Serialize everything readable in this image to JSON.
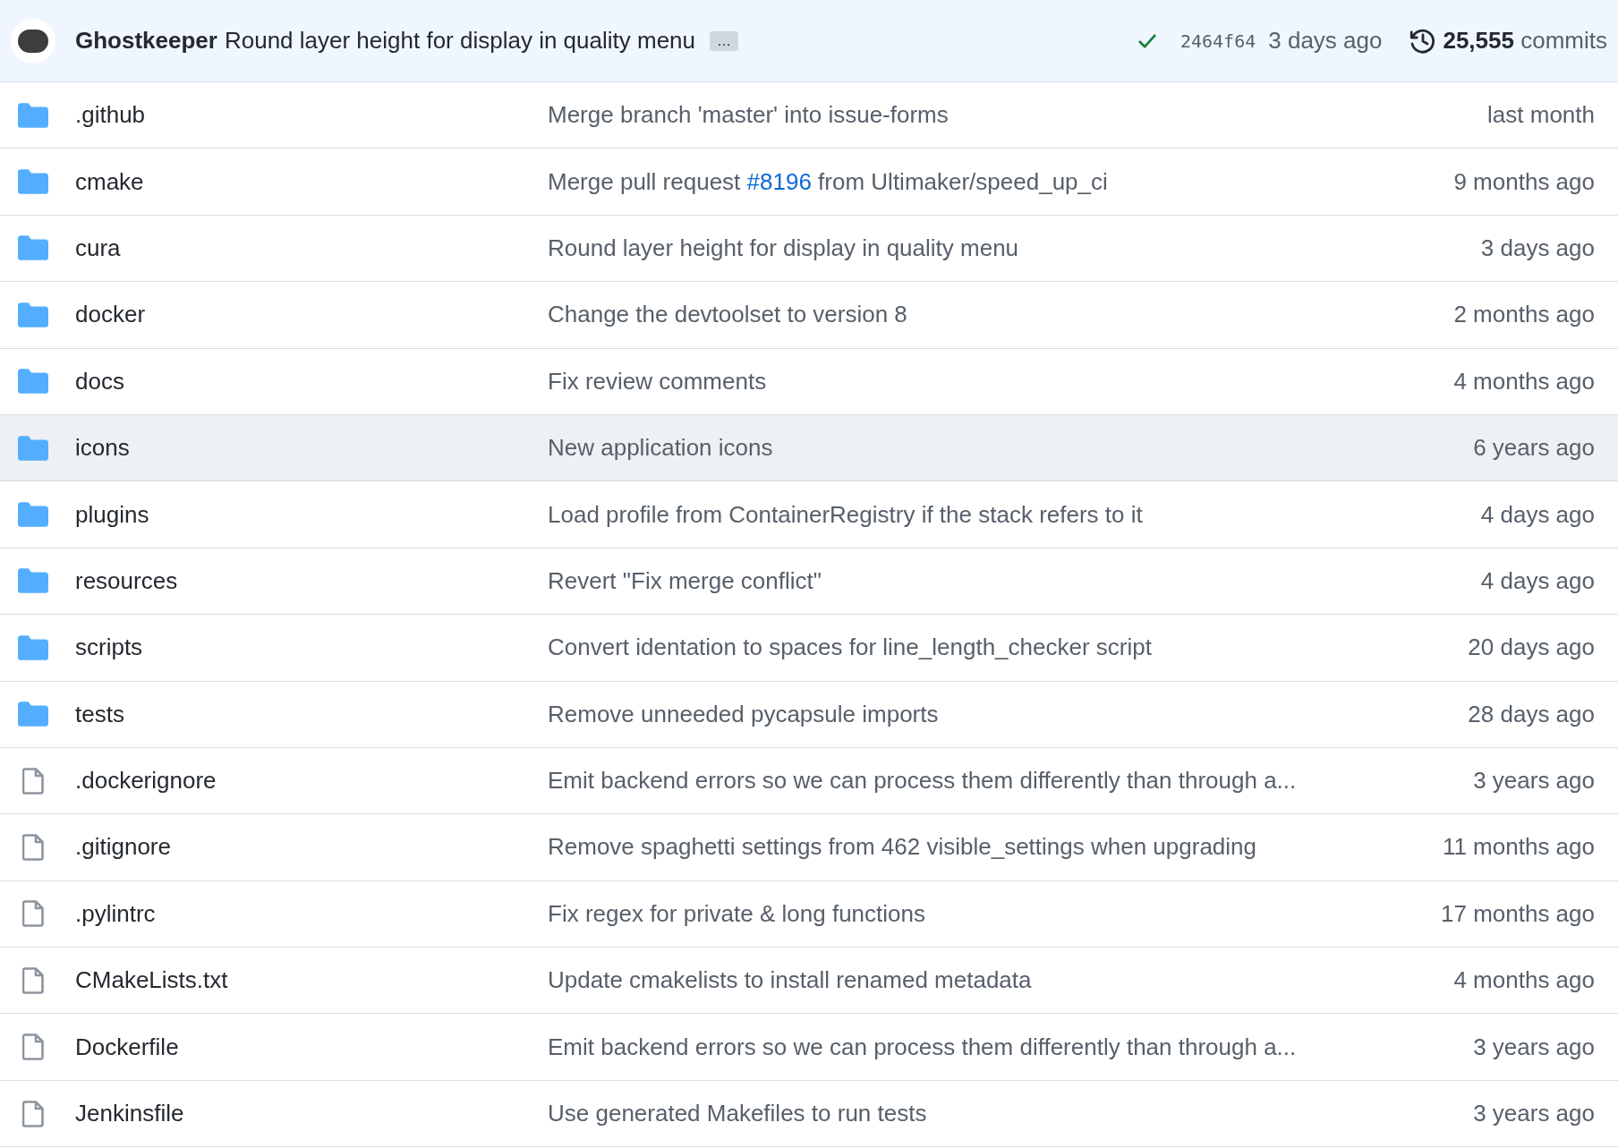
{
  "latest_commit": {
    "author": "Ghostkeeper",
    "message": "Round layer height for display in quality menu",
    "ellipsis": "…",
    "checks_passed": true,
    "sha": "2464f64",
    "age": "3 days ago",
    "commit_count": "25,555",
    "commit_label": "commits"
  },
  "files": [
    {
      "kind": "folder",
      "name": ".github",
      "message": [
        {
          "kind": "text",
          "text": "Merge branch 'master' into issue-forms"
        }
      ],
      "age": "last month",
      "highlighted": false
    },
    {
      "kind": "folder",
      "name": "cmake",
      "message": [
        {
          "kind": "text",
          "text": "Merge pull request "
        },
        {
          "kind": "link",
          "text": "#8196"
        },
        {
          "kind": "text",
          "text": " from Ultimaker/speed_up_ci"
        }
      ],
      "age": "9 months ago",
      "highlighted": false
    },
    {
      "kind": "folder",
      "name": "cura",
      "message": [
        {
          "kind": "text",
          "text": "Round layer height for display in quality menu"
        }
      ],
      "age": "3 days ago",
      "highlighted": false
    },
    {
      "kind": "folder",
      "name": "docker",
      "message": [
        {
          "kind": "text",
          "text": "Change the devtoolset to version 8"
        }
      ],
      "age": "2 months ago",
      "highlighted": false
    },
    {
      "kind": "folder",
      "name": "docs",
      "message": [
        {
          "kind": "text",
          "text": "Fix review comments"
        }
      ],
      "age": "4 months ago",
      "highlighted": false
    },
    {
      "kind": "folder",
      "name": "icons",
      "message": [
        {
          "kind": "text",
          "text": "New application icons"
        }
      ],
      "age": "6 years ago",
      "highlighted": true
    },
    {
      "kind": "folder",
      "name": "plugins",
      "message": [
        {
          "kind": "text",
          "text": "Load profile from ContainerRegistry if the stack refers to it"
        }
      ],
      "age": "4 days ago",
      "highlighted": false
    },
    {
      "kind": "folder",
      "name": "resources",
      "message": [
        {
          "kind": "text",
          "text": "Revert \"Fix merge conflict\""
        }
      ],
      "age": "4 days ago",
      "highlighted": false
    },
    {
      "kind": "folder",
      "name": "scripts",
      "message": [
        {
          "kind": "text",
          "text": "Convert identation to spaces for line_length_checker script"
        }
      ],
      "age": "20 days ago",
      "highlighted": false
    },
    {
      "kind": "folder",
      "name": "tests",
      "message": [
        {
          "kind": "text",
          "text": "Remove unneeded pycapsule imports"
        }
      ],
      "age": "28 days ago",
      "highlighted": false
    },
    {
      "kind": "file",
      "name": ".dockerignore",
      "message": [
        {
          "kind": "text",
          "text": "Emit backend errors so we can process them differently than through a..."
        }
      ],
      "age": "3 years ago",
      "highlighted": false
    },
    {
      "kind": "file",
      "name": ".gitignore",
      "message": [
        {
          "kind": "text",
          "text": "Remove spaghetti settings from 462 visible_settings when upgrading"
        }
      ],
      "age": "11 months ago",
      "highlighted": false
    },
    {
      "kind": "file",
      "name": ".pylintrc",
      "message": [
        {
          "kind": "text",
          "text": "Fix regex for private & long functions"
        }
      ],
      "age": "17 months ago",
      "highlighted": false
    },
    {
      "kind": "file",
      "name": "CMakeLists.txt",
      "message": [
        {
          "kind": "text",
          "text": "Update cmakelists to install renamed metadata"
        }
      ],
      "age": "4 months ago",
      "highlighted": false
    },
    {
      "kind": "file",
      "name": "Dockerfile",
      "message": [
        {
          "kind": "text",
          "text": "Emit backend errors so we can process them differently than through a..."
        }
      ],
      "age": "3 years ago",
      "highlighted": false
    },
    {
      "kind": "file",
      "name": "Jenkinsfile",
      "message": [
        {
          "kind": "text",
          "text": "Use generated Makefiles to run tests"
        }
      ],
      "age": "3 years ago",
      "highlighted": false
    }
  ]
}
